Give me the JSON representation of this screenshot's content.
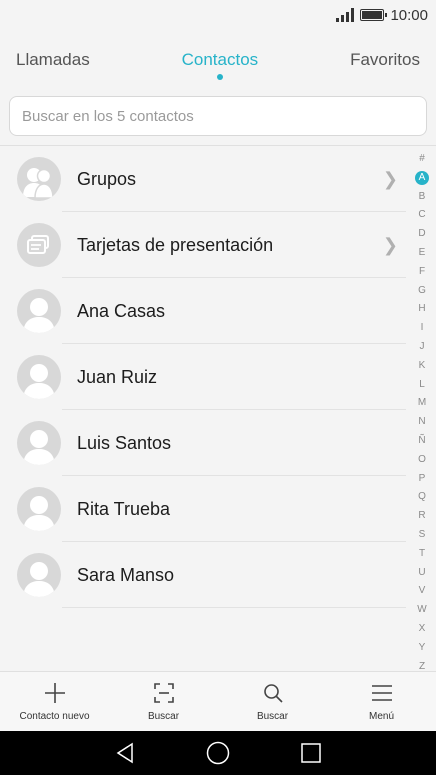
{
  "status": {
    "time": "10:00"
  },
  "tabs": [
    {
      "label": "Llamadas"
    },
    {
      "label": "Contactos"
    },
    {
      "label": "Favoritos"
    }
  ],
  "search": {
    "placeholder": "Buscar en los 5 contactos"
  },
  "list": [
    {
      "name": "Grupos",
      "icon": "groups-icon",
      "chevron": true
    },
    {
      "name": "Tarjetas de presentación",
      "icon": "business-cards-icon",
      "chevron": true
    },
    {
      "name": "Ana Casas",
      "icon": "contact-avatar-icon"
    },
    {
      "name": "Juan Ruiz",
      "icon": "contact-avatar-icon"
    },
    {
      "name": "Luis Santos",
      "icon": "contact-avatar-icon"
    },
    {
      "name": "Rita Trueba",
      "icon": "contact-avatar-icon"
    },
    {
      "name": "Sara Manso",
      "icon": "contact-avatar-icon"
    }
  ],
  "alphabet": [
    "#",
    "A",
    "B",
    "C",
    "D",
    "E",
    "F",
    "G",
    "H",
    "I",
    "J",
    "K",
    "L",
    "M",
    "N",
    "Ñ",
    "O",
    "P",
    "Q",
    "R",
    "S",
    "T",
    "U",
    "V",
    "W",
    "X",
    "Y",
    "Z"
  ],
  "alphabet_active": "A",
  "bottom_actions": [
    {
      "label": "Contacto nuevo",
      "icon": "plus-icon"
    },
    {
      "label": "Buscar",
      "icon": "scan-icon"
    },
    {
      "label": "Buscar",
      "icon": "search-icon"
    },
    {
      "label": "Menú",
      "icon": "menu-icon"
    }
  ],
  "colors": {
    "accent": "#27b3c9",
    "avatar": "#d8d8d8",
    "nav_bar": "#000000"
  }
}
